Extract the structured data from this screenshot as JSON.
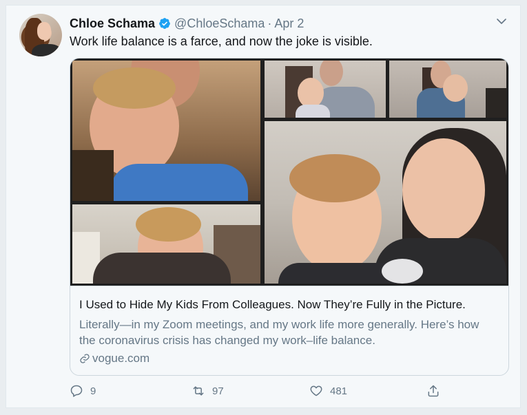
{
  "tweet": {
    "author_name": "Chloe Schama",
    "author_handle": "@ChloeSchama",
    "separator": "·",
    "date": "Apr 2",
    "text": "Work life balance is a farce, and now the joke is visible."
  },
  "card": {
    "title": "I Used to Hide My Kids From Colleagues. Now They’re Fully in the Picture.",
    "description": "Literally—in my Zoom meetings, and my work life more generally. Here’s how the coronavirus crisis has changed my work–life balance.",
    "domain": "vogue.com"
  },
  "actions": {
    "reply_count": "9",
    "retweet_count": "97",
    "like_count": "481"
  },
  "icons": {
    "verified": "verified-badge-icon",
    "menu": "chevron-down-icon",
    "link": "link-icon",
    "reply": "reply-icon",
    "retweet": "retweet-icon",
    "like": "heart-icon",
    "share": "share-icon"
  },
  "colors": {
    "accent": "#1da1f2",
    "text": "#14171a",
    "muted": "#657786",
    "border": "#ccd6dd"
  }
}
